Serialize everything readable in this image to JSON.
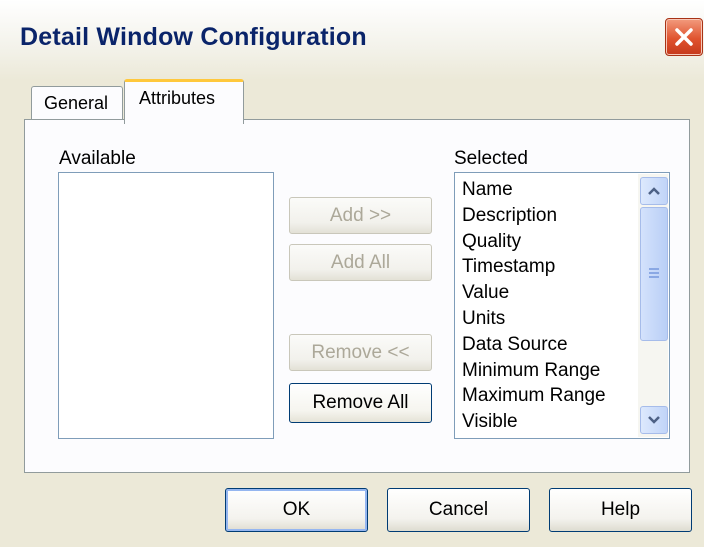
{
  "window": {
    "title": "Detail Window Configuration",
    "close_icon": "close-x-icon"
  },
  "tabs": [
    {
      "label": "General",
      "active": false
    },
    {
      "label": "Attributes",
      "active": true
    }
  ],
  "available": {
    "label": "Available",
    "items": []
  },
  "selected": {
    "label": "Selected",
    "items": [
      "Name",
      "Description",
      "Quality",
      "Timestamp",
      "Value",
      "Units",
      "Data Source",
      "Minimum Range",
      "Maximum Range",
      "Visible"
    ]
  },
  "transfer_buttons": {
    "add": "Add >>",
    "add_all": "Add All",
    "remove": "Remove <<",
    "remove_all": "Remove All"
  },
  "footer": {
    "ok": "OK",
    "cancel": "Cancel",
    "help": "Help"
  },
  "colors": {
    "accent": "#ffc83c",
    "title_text": "#0a246a",
    "close_button": "#e0532f"
  }
}
